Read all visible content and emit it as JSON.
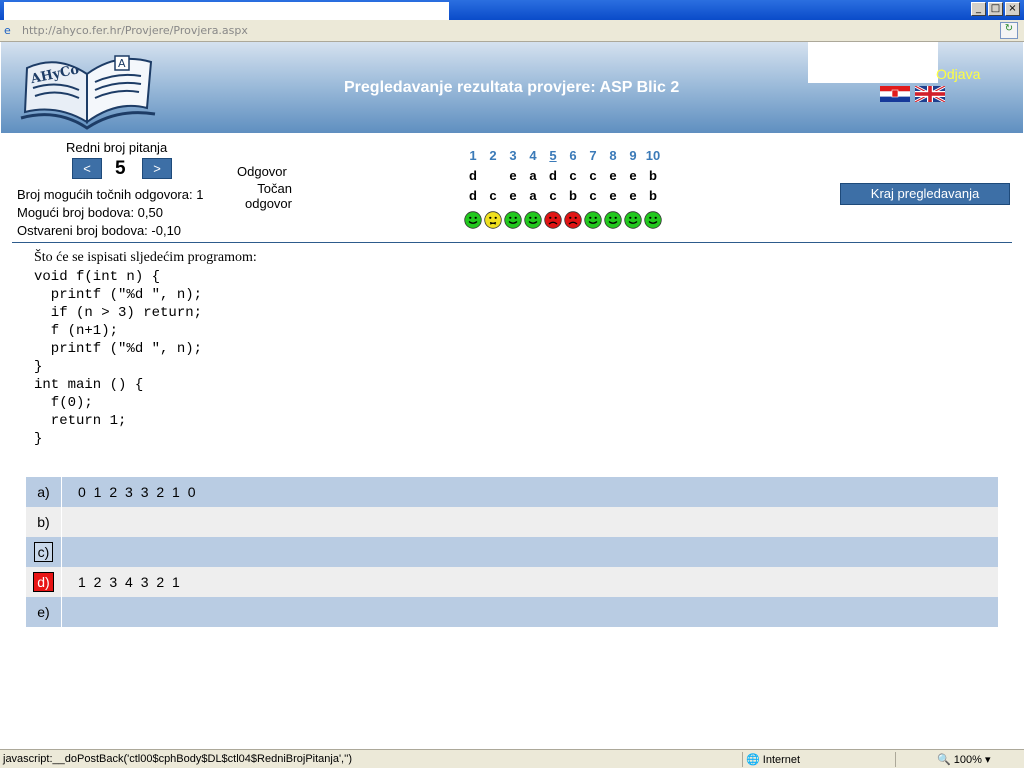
{
  "browser": {
    "address": "http://ahyco.fer.hr/Provjere/Provjera.aspx",
    "status_message": "javascript:__doPostBack('ctl00$cphBody$DL$ctl04$RedniBrojPitanja','')",
    "zone": "Internet",
    "zoom": "100%"
  },
  "header": {
    "logo_text": "AHyCo",
    "title": "Pregledavanje rezultata provjere: ASP Blic 2",
    "logout_label": "Odjava"
  },
  "navigation": {
    "question_label": "Redni broj pitanja",
    "prev_label": "<",
    "next_label": ">",
    "current_question": "5"
  },
  "stats": {
    "possible_correct": "Broj mogućih točnih odgovora: 1",
    "possible_points": "Mogući broj bodova: 0,50",
    "achieved_points": "Ostvareni broj bodova: -0,10"
  },
  "results": {
    "answer_label": "Odgovor",
    "correct_label_line1": "Točan",
    "correct_label_line2": "odgovor",
    "numbers": [
      "1",
      "2",
      "3",
      "4",
      "5",
      "6",
      "7",
      "8",
      "9",
      "10"
    ],
    "given": [
      "d",
      "",
      "e",
      "a",
      "d",
      "c",
      "c",
      "e",
      "e",
      "b"
    ],
    "correct": [
      "d",
      "c",
      "e",
      "a",
      "c",
      "b",
      "c",
      "e",
      "e",
      "b"
    ],
    "status": [
      "happy",
      "neutral",
      "happy",
      "happy",
      "sad",
      "sad",
      "happy",
      "happy",
      "happy",
      "happy"
    ],
    "status_colors": {
      "happy": "#22c81e",
      "neutral": "#f0e020",
      "sad": "#e01414"
    }
  },
  "end_button_label": "Kraj pregledavanja",
  "question": {
    "text": "Što će se ispisati sljedećim programom:",
    "code": "void f(int n) {\n  printf (\"%d \", n);\n  if (n > 3) return;\n  f (n+1);\n  printf (\"%d \", n);\n}\nint main () {\n  f(0);\n  return 1;\n}"
  },
  "answers": [
    {
      "letter": "a)",
      "text": "0 1 2 3 3 2 1 0",
      "mark": "none"
    },
    {
      "letter": "b)",
      "text": "",
      "mark": "none"
    },
    {
      "letter": "c)",
      "text": "",
      "mark": "outlined"
    },
    {
      "letter": "d)",
      "text": "1 2 3 4 3 2 1",
      "mark": "wrong"
    },
    {
      "letter": "e)",
      "text": "",
      "mark": "none"
    }
  ]
}
